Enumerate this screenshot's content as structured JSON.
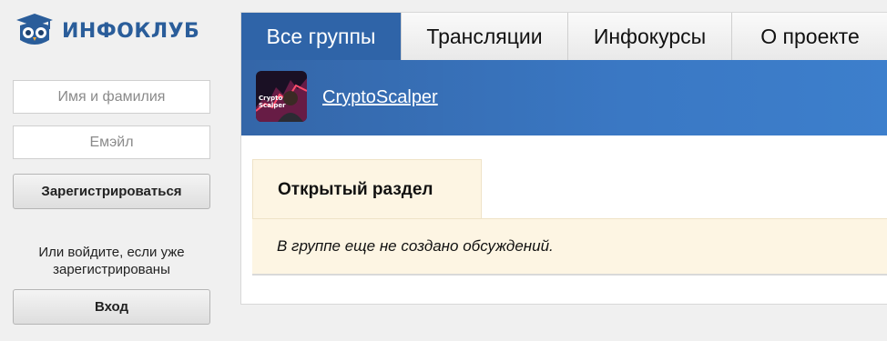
{
  "brand": {
    "logo_text": "ИНФОКЛУБ",
    "color": "#2a5d9a"
  },
  "auth": {
    "name_placeholder": "Имя и фамилия",
    "email_placeholder": "Емэйл",
    "register_label": "Зарегистрироваться",
    "login_hint": "Или войдите, если уже зарегистрированы",
    "login_label": "Вход"
  },
  "tabs": [
    {
      "label": "Все группы",
      "active": true
    },
    {
      "label": "Трансляции",
      "active": false
    },
    {
      "label": "Инфокурсы",
      "active": false
    },
    {
      "label": "О проекте",
      "active": false
    }
  ],
  "group": {
    "name": "CryptoScalper",
    "thumb_text": [
      "Crypto",
      "Scalper"
    ]
  },
  "section": {
    "title": "Открытый раздел",
    "empty_message": "В группе еще не создано обсуждений."
  },
  "colors": {
    "accent": "#2f64a8",
    "section_bg": "#fdf5e3",
    "page_bg": "#f0f0f0"
  }
}
